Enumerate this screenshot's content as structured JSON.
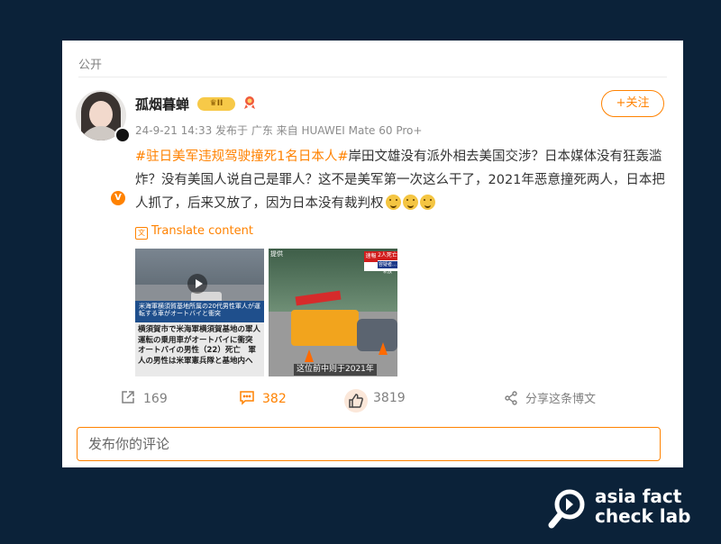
{
  "card": {
    "visibility": "公开",
    "user": {
      "name": "孤烟暮蝉",
      "level_badge": "II"
    },
    "meta": "24-9-21 14:33  发布于 广东  来自 HUAWEI Mate 60 Pro+",
    "follow_label": "+关注",
    "post": {
      "hashtag": "#驻日美军违规驾驶撞死1名日本人#",
      "text": "岸田文雄没有派外相去美国交涉？日本媒体没有狂轰滥炸？没有美国人说自己是罪人？这不是美军第一次这么干了，2021年恶意撞死两人，日本把人抓了，后来又放了，因为日本没有裁判权"
    },
    "translate_label": "Translate content",
    "images": [
      {
        "banner": "米海軍横須賀基地所属の20代男性軍人が運転する車がオートバイと衝突",
        "caption": "横須賀市で米海軍横須賀基地の軍人運転の乗用車がオートバイに衝突　オートバイの男性（22）死亡　軍人の男性は米軍憲兵隊と基地内へ"
      },
      {
        "corner": "提供",
        "tag_red": "速報",
        "tag_title": "2人死亡事故",
        "tag_sub": "容疑者…釈放",
        "caption": "这位前中则于2021年"
      }
    ],
    "actions": {
      "repost": "169",
      "comment": "382",
      "like": "3819",
      "share": "分享这条博文"
    },
    "comment_placeholder": "发布你的评论"
  },
  "watermark": {
    "line1": "asia fact",
    "line2": "check lab"
  },
  "colors": {
    "background": "#0b2239",
    "accent": "#ff8200"
  }
}
